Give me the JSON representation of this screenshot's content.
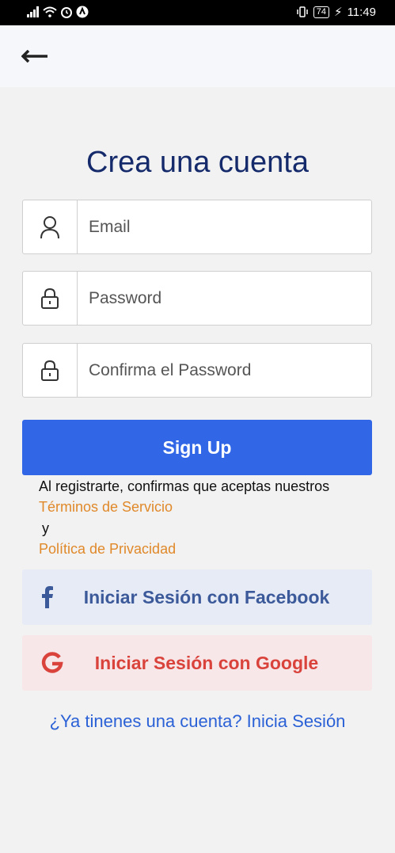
{
  "status_bar": {
    "battery": "74",
    "time": "11:49"
  },
  "page": {
    "title": "Crea una cuenta",
    "fields": {
      "email_placeholder": "Email",
      "password_placeholder": "Password",
      "confirm_placeholder": "Confirma el Password"
    },
    "signup_label": "Sign Up",
    "terms_text": "Al registrarte, confirmas que aceptas nuestros",
    "terms_link": "Términos de Servicio",
    "and_text": "y",
    "privacy_link": "Política de Privacidad",
    "facebook_label": "Iniciar Sesión con Facebook",
    "google_label": "Iniciar Sesión con Google",
    "login_prompt": "¿Ya tinenes una cuenta? Inicia Sesión"
  },
  "colors": {
    "title": "#152a6b",
    "primary_button": "#3166e6",
    "link_orange": "#e0892a",
    "facebook_text": "#3c5a9a",
    "facebook_bg": "#e6ebf6",
    "google_text": "#d9433b",
    "google_bg": "#f7e7e9",
    "login_link": "#2b61d6"
  }
}
